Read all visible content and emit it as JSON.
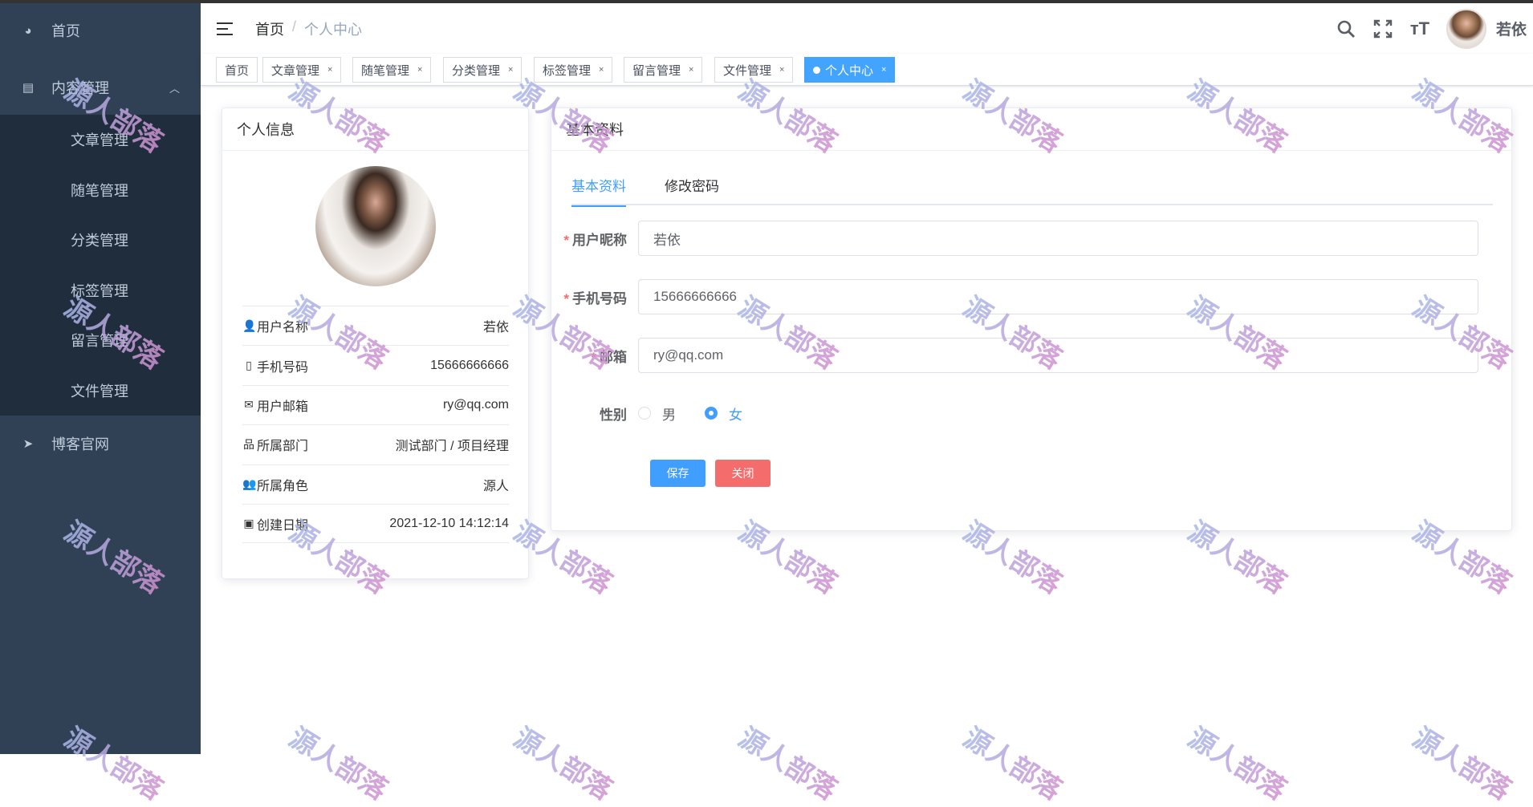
{
  "sidebar": {
    "home": "首页",
    "content_mgmt": "内容管理",
    "sub_items": [
      "文章管理",
      "随笔管理",
      "分类管理",
      "标签管理",
      "留言管理",
      "文件管理"
    ],
    "blog": "博客官网"
  },
  "header": {
    "breadcrumb": [
      "首页",
      "个人中心"
    ],
    "separator": "/",
    "username": "若依",
    "size_icon": "тT"
  },
  "tags": [
    {
      "label": "首页"
    },
    {
      "label": "文章管理"
    },
    {
      "label": "随笔管理"
    },
    {
      "label": "分类管理"
    },
    {
      "label": "标签管理"
    },
    {
      "label": "留言管理"
    },
    {
      "label": "文件管理"
    },
    {
      "label": "个人中心",
      "active": true
    }
  ],
  "tag_close": "×",
  "profile": {
    "title": "个人信息",
    "rows": [
      {
        "label": "用户名称",
        "value": "若依",
        "icon": "user-icon"
      },
      {
        "label": "手机号码",
        "value": "15666666666",
        "icon": "phone-icon"
      },
      {
        "label": "用户邮箱",
        "value": "ry@qq.com",
        "icon": "mail-icon"
      },
      {
        "label": "所属部门",
        "value": "测试部门 / 项目经理",
        "icon": "tree-icon"
      },
      {
        "label": "所属角色",
        "value": "源人",
        "icon": "peoples-icon"
      },
      {
        "label": "创建日期",
        "value": "2021-12-10 14:12:14",
        "icon": "date-icon"
      }
    ]
  },
  "basic": {
    "title": "基本资料",
    "tabs": [
      "基本资料",
      "修改密码"
    ],
    "fields": {
      "nickname": {
        "label": "用户昵称",
        "value": "若依"
      },
      "phone": {
        "label": "手机号码",
        "value": "15666666666"
      },
      "email": {
        "label": "邮箱",
        "value": "ry@qq.com"
      }
    },
    "gender": {
      "label": "性别",
      "options": [
        "男",
        "女"
      ],
      "selected": "女"
    },
    "required_mark": "*",
    "save": "保存",
    "close": "关闭"
  },
  "watermark": "源人部落",
  "colors": {
    "primary": "#409eff",
    "danger": "#f56c6c",
    "sidebar": "#304156"
  }
}
